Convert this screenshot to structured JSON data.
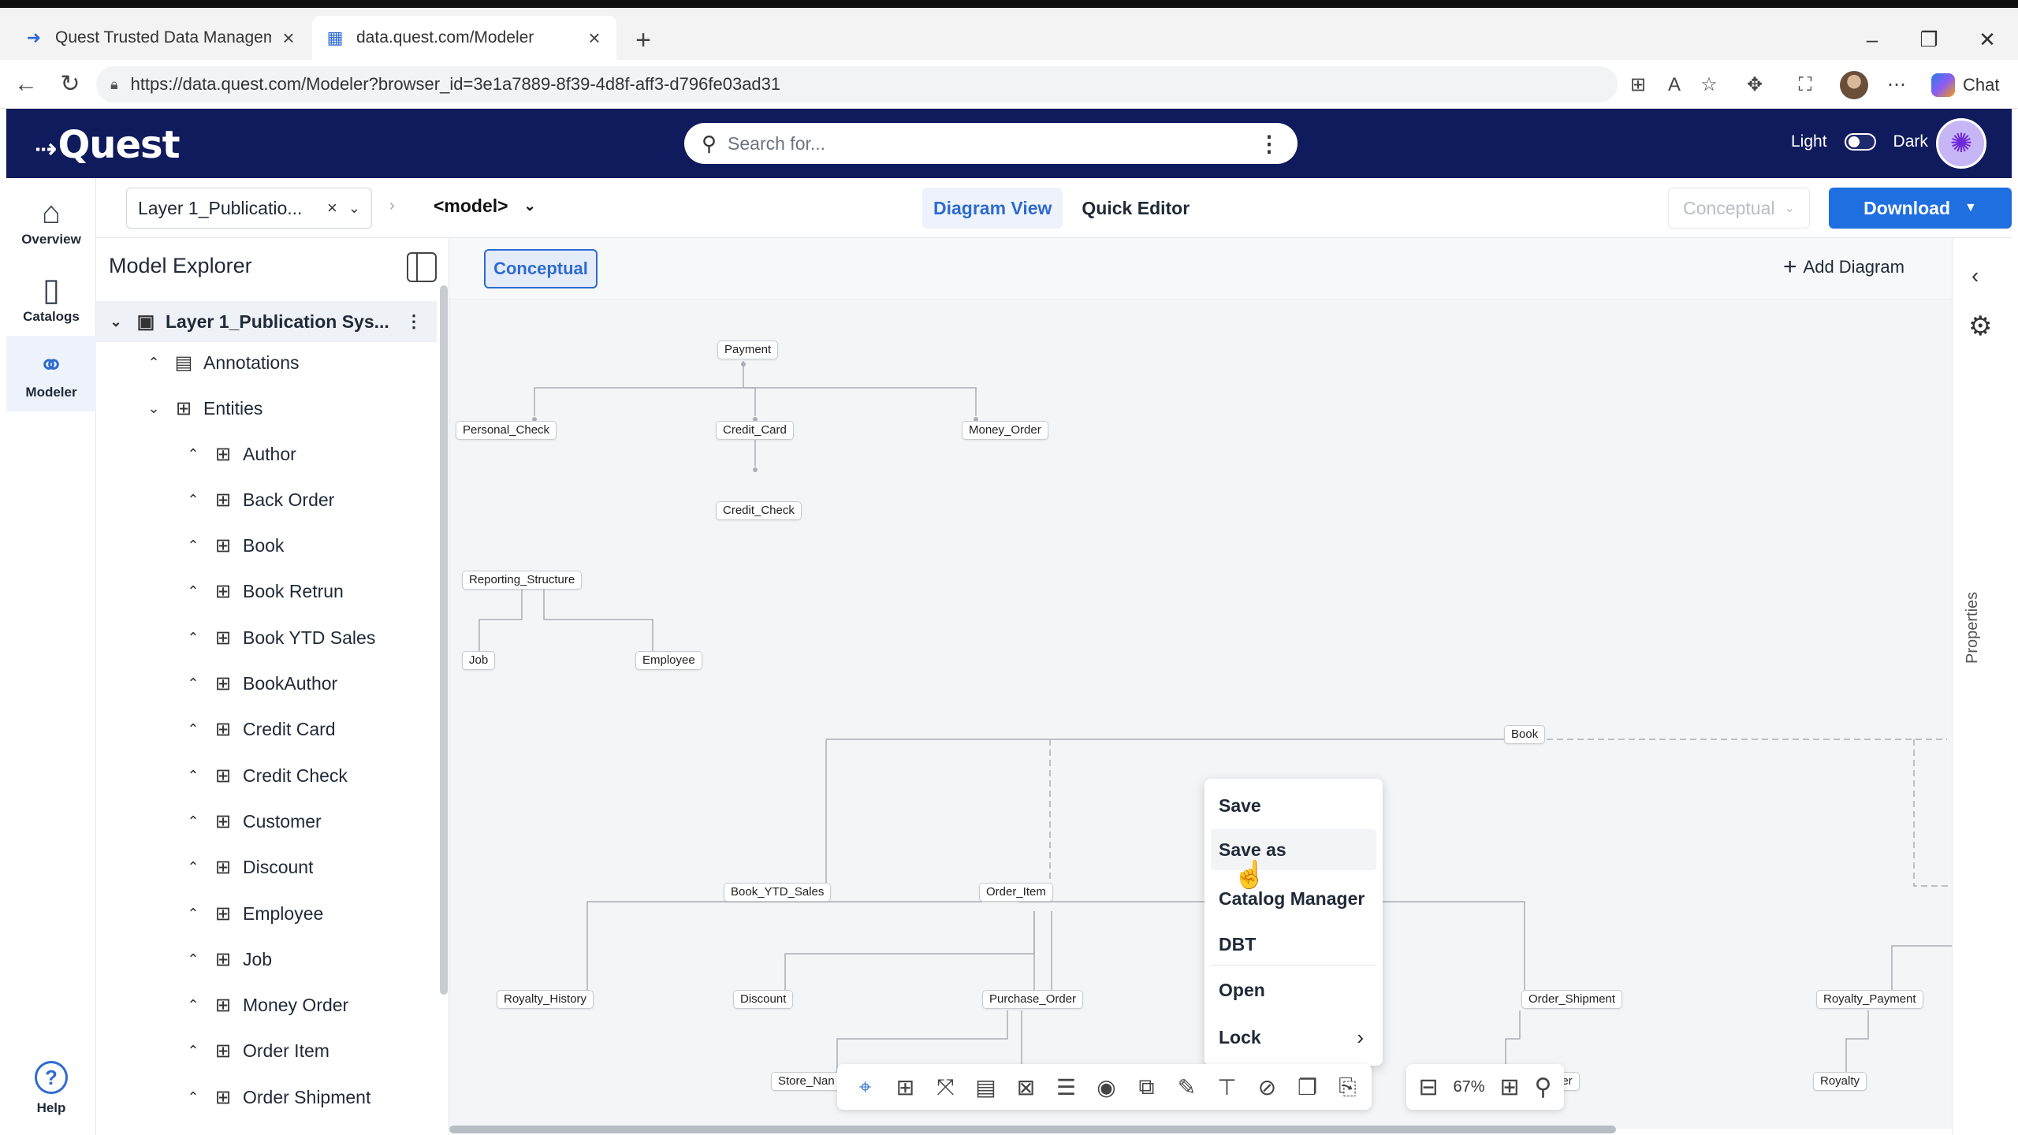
{
  "browser": {
    "tabs": [
      {
        "title": "Quest Trusted Data Management P",
        "icon": "arrow-icon"
      },
      {
        "title": "data.quest.com/Modeler",
        "icon": "grid-icon"
      }
    ],
    "url": "https://data.quest.com/Modeler?browser_id=3e1a7889-8f39-4d8f-aff3-d796fe03ad31",
    "chat_label": "Chat"
  },
  "header": {
    "logo": "Quest",
    "search_placeholder": "Search for...",
    "theme_light": "Light",
    "theme_dark": "Dark"
  },
  "leftnav": {
    "items": [
      {
        "label": "Overview",
        "icon": "home-icon"
      },
      {
        "label": "Catalogs",
        "icon": "book-icon"
      },
      {
        "label": "Modeler",
        "icon": "modeler-icon"
      }
    ],
    "help": "Help"
  },
  "toolbar": {
    "layer": "Layer 1_Publicatio...",
    "model": "<model>",
    "diagram_view": "Diagram View",
    "quick_editor": "Quick Editor",
    "level": "Conceptual",
    "download": "Download"
  },
  "explorer": {
    "title": "Model Explorer",
    "root": "Layer 1_Publication Sys...",
    "annotations": "Annotations",
    "entities_label": "Entities",
    "entities": [
      "Author",
      "Back Order",
      "Book",
      "Book Retrun",
      "Book YTD Sales",
      "BookAuthor",
      "Credit Card",
      "Credit Check",
      "Customer",
      "Discount",
      "Employee",
      "Job",
      "Money Order",
      "Order Item",
      "Order Shipment"
    ]
  },
  "canvas": {
    "tab": "Conceptual",
    "add_diagram": "Add Diagram",
    "entities": [
      "Payment",
      "Personal_Check",
      "Credit_Card",
      "Money_Order",
      "Credit_Check",
      "Reporting_Structure",
      "Job",
      "Employee",
      "Book",
      "Book_YTD_Sales",
      "Order_Item",
      "Royalty_History",
      "Discount",
      "Purchase_Order",
      "Order_Shipment",
      "Royalty_Payment",
      "Royalty",
      "Store_Nan",
      "rder"
    ],
    "zoom": "67%"
  },
  "context_menu": {
    "items": [
      "Save",
      "Save as",
      "Catalog Manager",
      "DBT",
      "Open",
      "Lock"
    ]
  },
  "properties_label": "Properties",
  "colors": {
    "header": "#0f1b5c",
    "accent": "#1f6fe0",
    "selected": "#2e6bd1"
  }
}
